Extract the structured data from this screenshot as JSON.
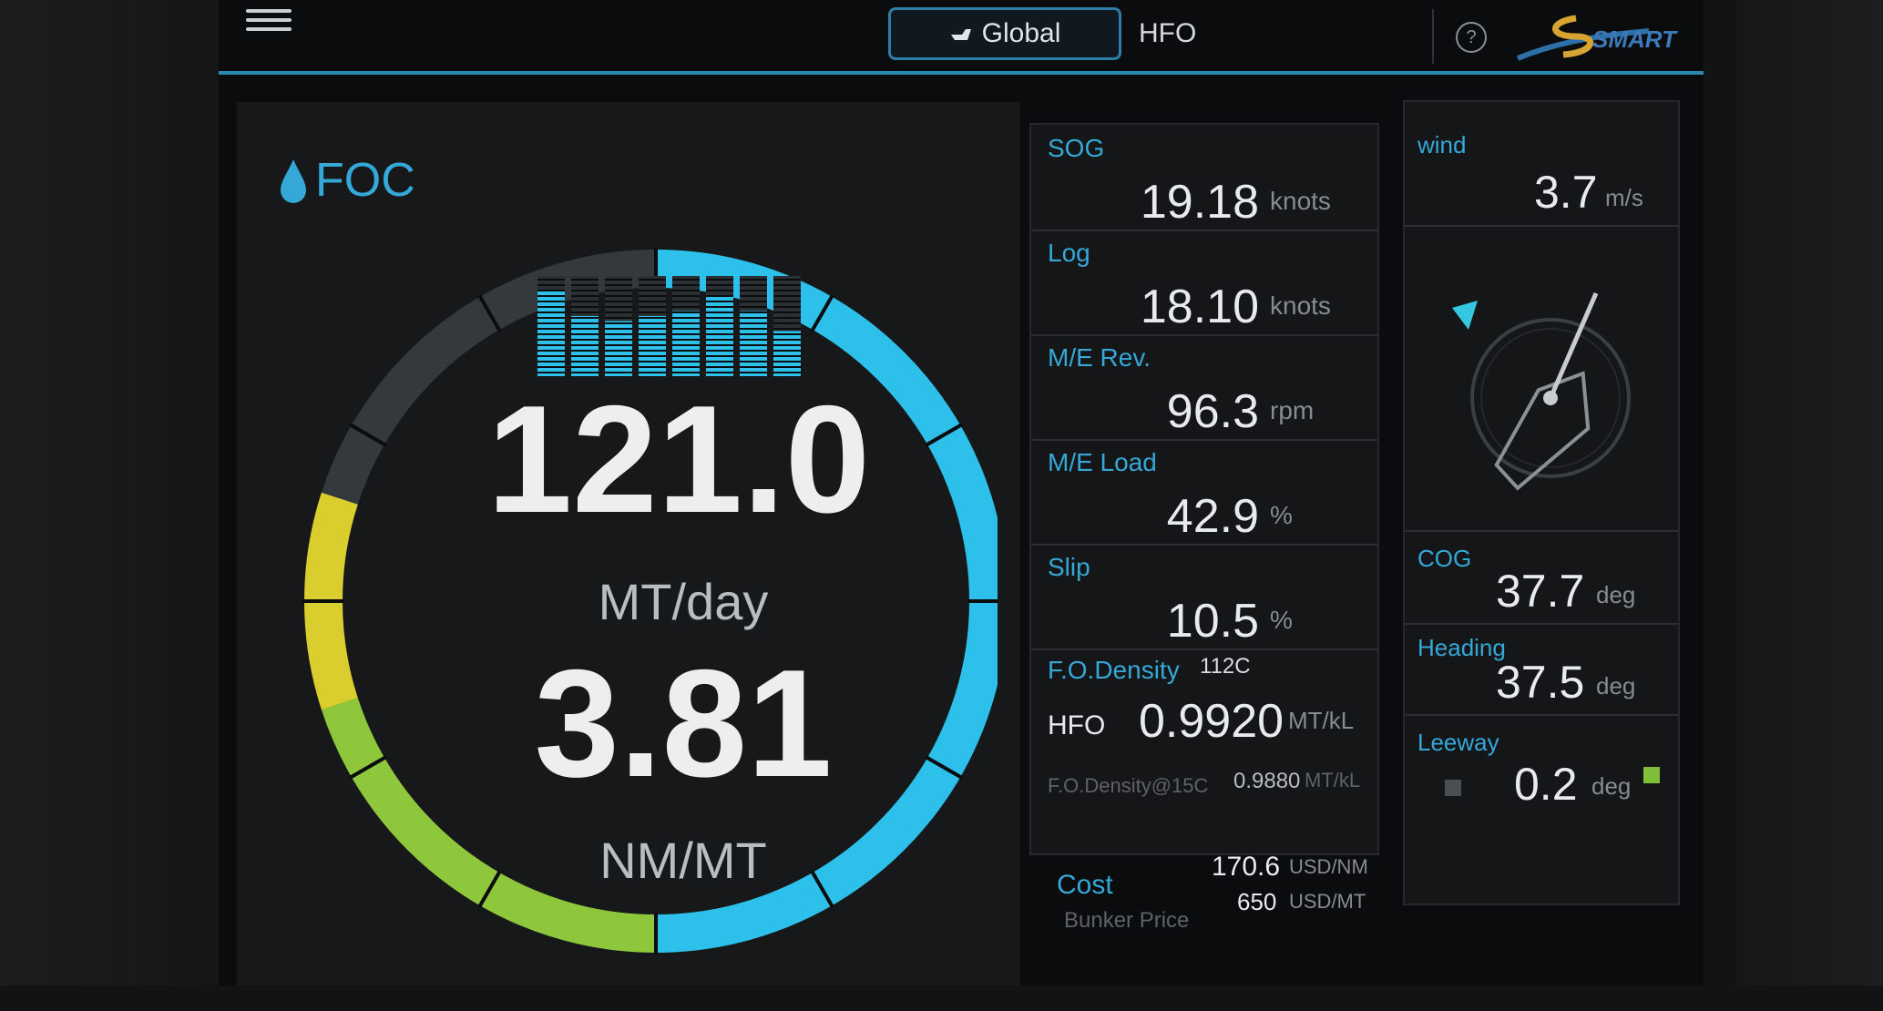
{
  "topbar": {
    "tab_global_label": "Global",
    "tab_hfo_label": "HFO",
    "help_label": "?",
    "logo_text": "SMARTSHIP"
  },
  "foc": {
    "title": "FOC",
    "consumption_value": "121.0",
    "consumption_unit": "MT/day",
    "efficiency_value": "3.81",
    "efficiency_unit": "NM/MT",
    "history_bars": [
      0.85,
      0.6,
      0.55,
      0.6,
      0.65,
      0.8,
      0.65,
      0.45
    ],
    "gauge_segments": [
      {
        "color": "#2cc0ea",
        "share": 0.5
      },
      {
        "color": "#8ec73c",
        "share": 0.2
      },
      {
        "color": "#d9ce2e",
        "share": 0.1
      },
      {
        "color": "#34393e",
        "share": 0.2
      }
    ]
  },
  "metrics": [
    {
      "label": "SOG",
      "value": "19.18",
      "unit": "knots"
    },
    {
      "label": "Log",
      "value": "18.10",
      "unit": "knots"
    },
    {
      "label": "M/E Rev.",
      "value": "96.3",
      "unit": "rpm"
    },
    {
      "label": "M/E Load",
      "value": "42.9",
      "unit": "%"
    },
    {
      "label": "Slip",
      "value": "10.5",
      "unit": "%"
    }
  ],
  "density": {
    "label": "F.O.Density",
    "temp": "112C",
    "fuel": "HFO",
    "value": "0.9920",
    "unit": "MT/kL",
    "ref_label": "F.O.Density@15C",
    "ref_value": "0.9880",
    "ref_unit": "MT/kL"
  },
  "cost": {
    "label": "Cost",
    "cost_value": "170.6",
    "cost_unit": "USD/NM",
    "bunker_label": "Bunker Price",
    "bunker_value": "650",
    "bunker_unit": "USD/MT"
  },
  "nav": {
    "wind_label": "wind",
    "wind_value": "3.7",
    "wind_unit": "m/s",
    "cog_label": "COG",
    "cog_value": "37.7",
    "cog_unit": "deg",
    "heading_label": "Heading",
    "heading_value": "37.5",
    "heading_unit": "deg",
    "leeway_label": "Leeway",
    "leeway_value": "0.2",
    "leeway_unit": "deg"
  },
  "colors": {
    "accent": "#35a8d7",
    "gauge_blue": "#2cc0ea",
    "gauge_green": "#8ec73c",
    "gauge_yellow": "#d9ce2e"
  }
}
